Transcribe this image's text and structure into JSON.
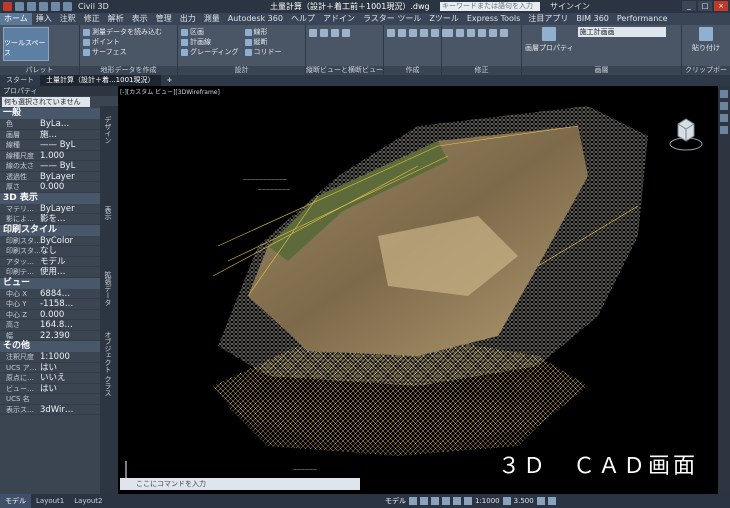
{
  "titlebar": {
    "workspace": "Civil 3D",
    "document": "土量計算（設計＋着工前＋1001現況）.dwg",
    "search_placeholder": "キーワードまたは語句を入力",
    "signin": "サインイン"
  },
  "ribbon_tabs": [
    "ホーム",
    "挿入",
    "注釈",
    "修正",
    "解析",
    "表示",
    "管理",
    "出力",
    "測量",
    "Autodesk 360",
    "ヘルプ",
    "アドイン",
    "ラスター ツール",
    "Zツール",
    "Express Tools",
    "注目アプリ",
    "BIM 360",
    "Performance"
  ],
  "ribbon": {
    "toolspace_label": "ツールスペース",
    "palette_title": "パレット",
    "terrain_items": [
      "測量データを読み込む",
      "ポイント",
      "サーフェス"
    ],
    "terrain_title": "地形データを作成",
    "design_items": [
      "区画",
      "計画線",
      "グレーディング",
      "線形",
      "縦断",
      "コリドー"
    ],
    "design_title": "設計",
    "profile_title": "縦断ビューと横断ビュー",
    "create_title": "作成",
    "modify_title": "修正",
    "layer_props_label": "画層プロパティ",
    "layer_name": "施工計画画",
    "layer_title": "画層",
    "paste_label": "貼り付け",
    "clipboard_title": "クリップボード"
  },
  "file_tabs": [
    "スタート",
    "土量計算（設計＋着...1001現況）",
    "+"
  ],
  "props": {
    "header": "プロパティ",
    "select_value": "何も選択されていません",
    "sections": [
      {
        "title": "一般",
        "rows": [
          {
            "k": "色",
            "v": "ByLa…"
          },
          {
            "k": "画層",
            "v": "施…"
          },
          {
            "k": "線種",
            "v": "—— ByL"
          },
          {
            "k": "線種尺度",
            "v": "1.000"
          },
          {
            "k": "線の太さ",
            "v": "—— ByL"
          },
          {
            "k": "透過性",
            "v": "ByLayer"
          },
          {
            "k": "厚さ",
            "v": "0.000"
          }
        ]
      },
      {
        "title": "3D 表示",
        "rows": [
          {
            "k": "マテリ…",
            "v": "ByLayer"
          },
          {
            "k": "影によ…",
            "v": "影を…"
          }
        ]
      },
      {
        "title": "印刷スタイル",
        "rows": [
          {
            "k": "印刷スタ…",
            "v": "ByColor"
          },
          {
            "k": "印刷スタ…",
            "v": "なし"
          },
          {
            "k": "アタッ…",
            "v": "モデル"
          },
          {
            "k": "印刷テ…",
            "v": "使用…"
          }
        ]
      },
      {
        "title": "ビュー",
        "rows": [
          {
            "k": "中心 X",
            "v": "6884…"
          },
          {
            "k": "中心 Y",
            "v": "-1158…"
          },
          {
            "k": "中心 Z",
            "v": "0.000"
          },
          {
            "k": "高さ",
            "v": "164.8…"
          },
          {
            "k": "幅",
            "v": "22.390"
          }
        ]
      },
      {
        "title": "その他",
        "rows": [
          {
            "k": "注釈尺度",
            "v": "1:1000"
          },
          {
            "k": "UCS ア…",
            "v": "はい"
          },
          {
            "k": "原点に…",
            "v": "いいえ"
          },
          {
            "k": "ビュー…",
            "v": "はい"
          },
          {
            "k": "UCS 名",
            "v": ""
          },
          {
            "k": "表示ス…",
            "v": "3dWir…"
          }
        ]
      }
    ],
    "side_tabs": [
      "デザイン",
      "表示",
      "拡張データ",
      "オブジェクト クラス"
    ]
  },
  "viewport": {
    "label": "[-][カスタム ビュー][3DWireframe]",
    "caption": "３Ｄ　ＣＡＤ画面",
    "cmd_placeholder": "ここにコマンドを入力"
  },
  "status": {
    "tabs": [
      "モデル",
      "Layout1",
      "Layout2"
    ],
    "model_label": "モデル",
    "scale": "1:1000",
    "zoom": "3.500"
  },
  "colors": {
    "mesh_yellow": "#e8c34a",
    "terrain_brown": "#8a7450",
    "accent_blue": "#5a7898"
  }
}
